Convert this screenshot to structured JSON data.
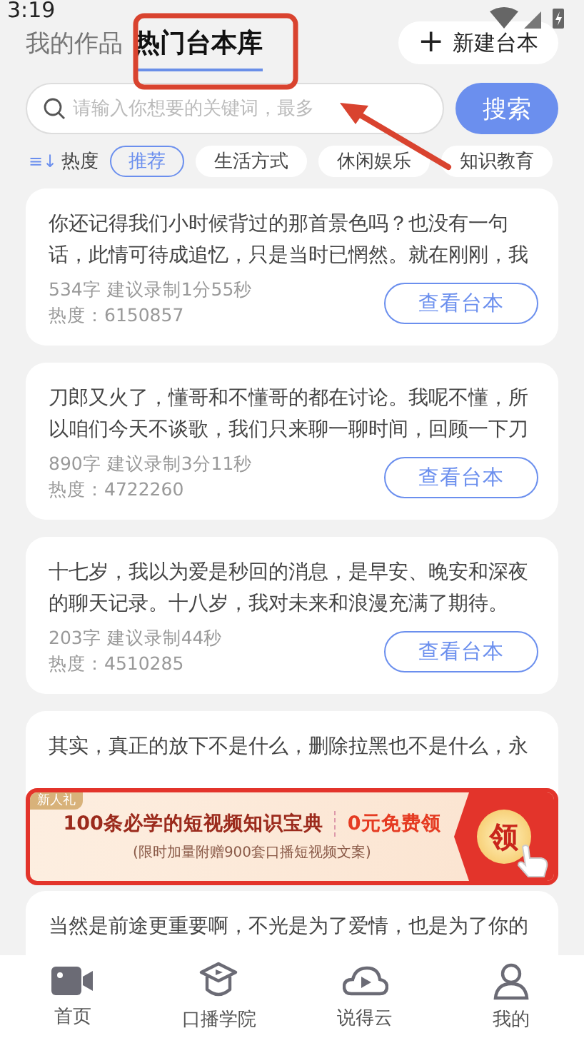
{
  "status_bar": {
    "time": "3:19"
  },
  "tabs": [
    {
      "label": "我的作品",
      "selected": false
    },
    {
      "label": "热门台本库",
      "selected": true
    }
  ],
  "new_button": {
    "icon": "+",
    "label": "新建台本"
  },
  "search": {
    "placeholder": "请输入你想要的关键词，最多",
    "button": "搜索"
  },
  "sort": {
    "icon": "≡↓",
    "label": "热度"
  },
  "categories": [
    {
      "label": "推荐",
      "selected": true
    },
    {
      "label": "生活方式",
      "selected": false
    },
    {
      "label": "休闲娱乐",
      "selected": false
    },
    {
      "label": "知识教育",
      "selected": false
    }
  ],
  "scripts": [
    {
      "text": "你还记得我们小时候背过的那首景色吗？也没有一句话，此情可待成追忆，只是当时已惘然。就在刚刚，我",
      "meta": "534字 建议录制1分55秒",
      "heat": "热度：6150857",
      "button": "查看台本"
    },
    {
      "text": "刀郎又火了，懂哥和不懂哥的都在讨论。我呢不懂，所以咱们今天不谈歌，我们只来聊一聊时间，回顾一下刀",
      "meta": "890字 建议录制3分11秒",
      "heat": "热度：4722260",
      "button": "查看台本"
    },
    {
      "text": "十七岁，我以为爱是秒回的消息，是早安、晚安和深夜的聊天记录。十八岁，我对未来和浪漫充满了期待。",
      "meta": "203字 建议录制44秒",
      "heat": "热度：4510285",
      "button": "查看台本"
    },
    {
      "text": "其实，真正的放下不是什么，删除拉黑也不是什么，永"
    },
    {
      "text": "当然是前途更重要啊，不光是为了爱情，也是为了你的"
    }
  ],
  "promo": {
    "tag": "新人礼",
    "title": "100条必学的短视频知识宝典",
    "offer": "0元免费领",
    "subtitle": "(限时加量附赠900套口播短视频文案)",
    "claim": "领"
  },
  "nav": [
    {
      "kind": "camera",
      "label": "首页"
    },
    {
      "kind": "academy",
      "label": "口播学院"
    },
    {
      "kind": "cloud",
      "label": "说得云"
    },
    {
      "kind": "person",
      "label": "我的"
    }
  ]
}
